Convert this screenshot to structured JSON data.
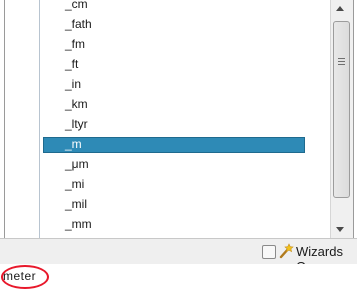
{
  "unit_list": {
    "items": [
      {
        "label": "_cm",
        "selected": false
      },
      {
        "label": "_fath",
        "selected": false
      },
      {
        "label": "_fm",
        "selected": false
      },
      {
        "label": "_ft",
        "selected": false
      },
      {
        "label": "_in",
        "selected": false
      },
      {
        "label": "_km",
        "selected": false
      },
      {
        "label": "_ltyr",
        "selected": false
      },
      {
        "label": "_m",
        "selected": true
      },
      {
        "label": "_μm",
        "selected": false
      },
      {
        "label": "_mi",
        "selected": false
      },
      {
        "label": "_mil",
        "selected": false
      },
      {
        "label": "_mm",
        "selected": false
      }
    ]
  },
  "toolbar": {
    "wizards_label": "Wizards On",
    "wizards_checked": false,
    "wizard_icon": "wand-icon"
  },
  "description": {
    "text": "meter",
    "highlight_color": "#e8182b"
  },
  "colors": {
    "selection": "#2e8ab6"
  }
}
